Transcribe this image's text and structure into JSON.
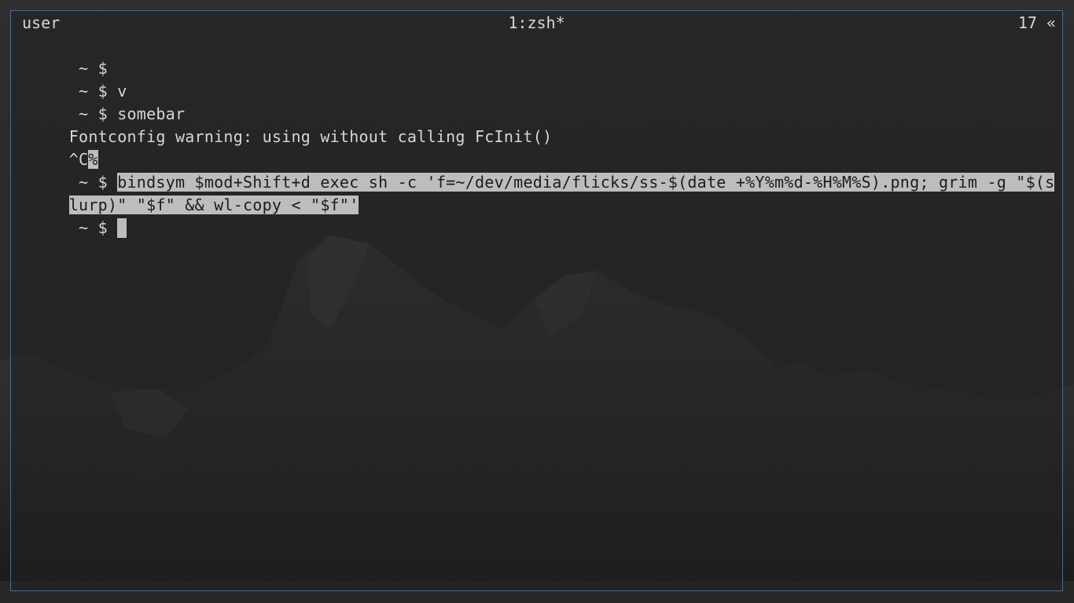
{
  "statusbar": {
    "session": "user",
    "window": "1:zsh*",
    "right": "17 «"
  },
  "terminal": {
    "prompt": " ~ $ ",
    "lines": [
      {
        "prompt": " ~ $ ",
        "text": ""
      },
      {
        "prompt": " ~ $ ",
        "text": "v"
      },
      {
        "prompt": " ~ $ ",
        "text": "somebar"
      },
      {
        "text": "Fontconfig warning: using without calling FcInit()"
      },
      {
        "text": "^C",
        "marker": "%"
      },
      {
        "prompt": " ~ $ ",
        "selected_text": "bindsym $mod+Shift+d exec sh -c 'f=~/dev/media/flicks/ss-$(date +%Y%m%d-%H%M%S).png; grim -g \"$(s"
      },
      {
        "selected_text": "lurp)\" \"$f\" && wl-copy < \"$f\"'"
      },
      {
        "prompt": " ~ $ ",
        "text": ""
      }
    ]
  },
  "colors": {
    "background": "#2b2b2b",
    "text": "#d6d6d6",
    "selection": "#bdbdbd",
    "border": "#4a6a8a"
  }
}
